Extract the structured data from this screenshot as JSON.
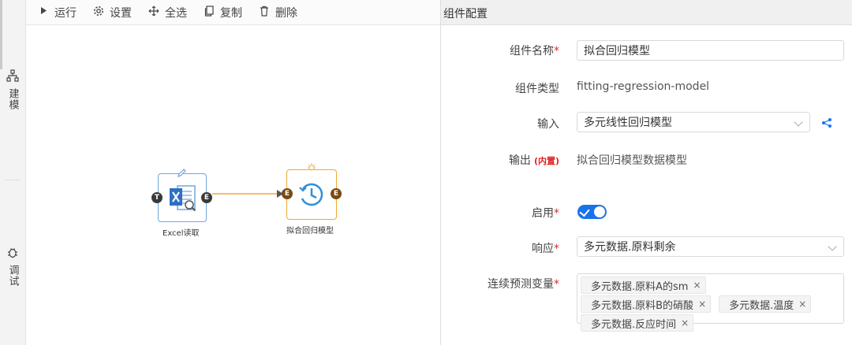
{
  "sidebar": {
    "items": [
      {
        "label": "建模",
        "icon": "sitemap-icon"
      },
      {
        "label": "调试",
        "icon": "bug-icon"
      }
    ]
  },
  "toolbar": {
    "buttons": [
      {
        "label": "运行",
        "icon": "play-icon"
      },
      {
        "label": "设置",
        "icon": "gear-icon"
      },
      {
        "label": "全选",
        "icon": "move-icon"
      },
      {
        "label": "复制",
        "icon": "copy-icon"
      },
      {
        "label": "删除",
        "icon": "trash-icon"
      }
    ]
  },
  "canvas": {
    "nodes": [
      {
        "label": "Excel读取",
        "icon": "excel-icon",
        "input_port": "T",
        "output_port": "E",
        "border_color": "#6fa8dc",
        "badge_icon": "pencil-icon"
      },
      {
        "label": "拟合回归模型",
        "icon": "clock-icon",
        "input_port": "E",
        "output_port": "E",
        "border_color": "#f0a830",
        "badge_icon": "lightbulb-icon"
      }
    ],
    "edge_color": "#f0a830"
  },
  "panel": {
    "title": "组件配置",
    "fields": {
      "name": {
        "label": "组件名称",
        "required": "*",
        "value": "拟合回归模型"
      },
      "type": {
        "label": "组件类型",
        "value": "fitting-regression-model"
      },
      "input": {
        "label": "输入",
        "value": "多元线性回归模型",
        "share_icon": "share-icon"
      },
      "output": {
        "label": "输出",
        "tag": "(内置)",
        "value": "拟合回归模型数据模型"
      },
      "enable": {
        "label": "启用",
        "required": "*",
        "on": true
      },
      "response": {
        "label": "响应",
        "required": "*",
        "value": "多元数据.原料剩余"
      },
      "predictors": {
        "label": "连续预测变量",
        "required": "*",
        "tags": [
          "多元数据.原料A的sm",
          "多元数据.原料B的硝酸",
          "多元数据.温度",
          "多元数据.反应时间"
        ],
        "remove_glyph": "×"
      }
    }
  },
  "colors": {
    "accent": "#1a73e8",
    "required": "#d03030",
    "node_blue": "#6fa8dc",
    "node_orange": "#f0a830",
    "port_dark": "#3a3a3a"
  }
}
